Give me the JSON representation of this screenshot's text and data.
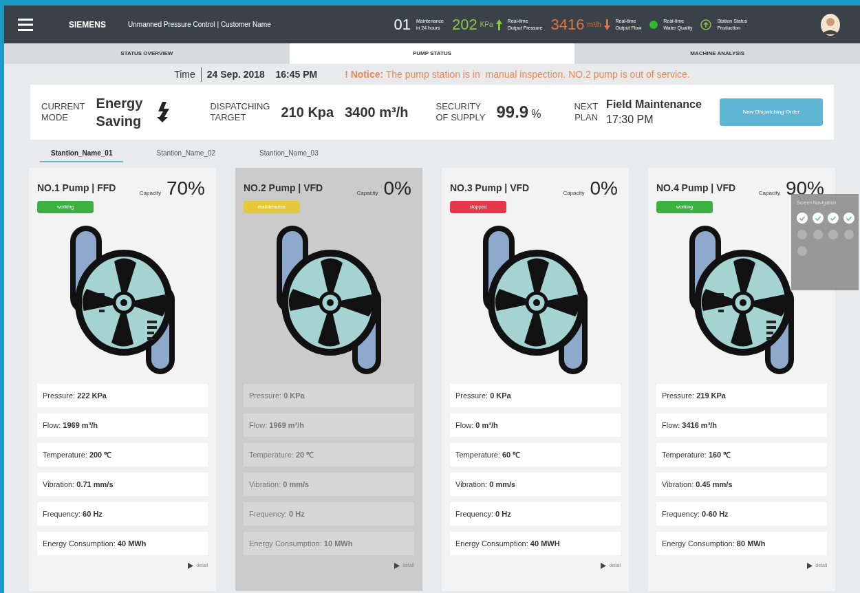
{
  "top_bar": {
    "brand": "SIEMENS",
    "title": "Unmanned Pressure Control | Customer Name",
    "stats": [
      {
        "kind": "count",
        "value": "01",
        "caption": [
          "Maintenance",
          "in 24 hours"
        ]
      },
      {
        "kind": "up",
        "value": "202",
        "unit": "KPa",
        "caption": [
          "Real-time",
          "Output Pressure"
        ]
      },
      {
        "kind": "down",
        "value": "3416",
        "unit": "m³/h",
        "caption": [
          "Real-time",
          "Output Flow"
        ]
      },
      {
        "kind": "dot",
        "caption": [
          "Real-time",
          "Water Quality"
        ]
      },
      {
        "kind": "status",
        "caption": [
          "Station Status",
          "Production"
        ]
      }
    ]
  },
  "tabs": [
    {
      "label": "STATUS OVERVIEW",
      "selected": false
    },
    {
      "label": "PUMP STATUS",
      "selected": true
    },
    {
      "label": "MACHINE ANALYSIS",
      "selected": false
    }
  ],
  "time_label": "Time",
  "time_value": "24 Sep. 2018    16:45 PM",
  "notice": "**! Notice:** The pump station is in  manual inspection. NO.2 pump is out of service.",
  "info": {
    "mode_label": [
      "CURRENT",
      "MODE"
    ],
    "mode": "Energy Saving",
    "target_label": [
      "DISPATCHING",
      "TARGET"
    ],
    "target_pressure": "210 Kpa",
    "target_flow": "3400 m³/h",
    "security_label": [
      "SECURITY",
      "OF SUPPLY"
    ],
    "security_value": "99.9",
    "security_unit": "%",
    "plan_label": [
      "NEXT",
      "PLAN"
    ],
    "plan_title": "Field Maintenance",
    "plan_time": "17:30 PM",
    "button": "New Dispatching Order"
  },
  "stations": [
    {
      "label": "Stantion_Name_01",
      "selected": true
    },
    {
      "label": "Stantion_Name_02",
      "selected": false
    },
    {
      "label": "Stantion_Name_03",
      "selected": false
    }
  ],
  "pumps": [
    {
      "title": "NO.1 Pump | FFD",
      "capacity_label": "Capacity",
      "capacity": "70%",
      "status": "working",
      "metrics": [
        "Pressure: **222 KPa**",
        "Flow: **1969 m³/h**",
        "Temperature: **200 ℃**",
        "Vibration: **0.71 mm/s**",
        "Frequency: **60 Hz**",
        "Energy Consumption: **40 MWh**"
      ],
      "detail": "detail"
    },
    {
      "title": "NO.2 Pump | VFD",
      "capacity_label": "Capacity",
      "capacity": "0%",
      "status": "maintenance",
      "metrics": [
        "Pressure: **0 KPa**",
        "Flow: **1969 m³/h**",
        "Temperature: **20 ℃**",
        "Vibration: **0 mm/s**",
        "Frequency: **0 Hz**",
        "Energy Consumption: **10 MWh**"
      ],
      "detail": "detail"
    },
    {
      "title": "NO.3 Pump | VFD",
      "capacity_label": "Capacity",
      "capacity": "0%",
      "status": "stopped",
      "metrics": [
        "Pressure: **0 KPa**",
        "Flow: **0 m³/h**",
        "Temperature: **60 ℃**",
        "Vibration: **0 mm/s**",
        "Frequency: **0 Hz**",
        "Energy Consumption: **40 MWH**"
      ],
      "detail": "detail"
    },
    {
      "title": "NO.4 Pump | VFD",
      "capacity_label": "Capacity",
      "capacity": "90%",
      "status": "working",
      "metrics": [
        "Pressure: **219 KPa**",
        "Flow: **3416 m³/h**",
        "Temperature: **160 ℃**",
        "Vibration: **0.45 mm/s**",
        "Frequency: **0-60 Hz**",
        "Energy Consumption: **80 MWh**"
      ],
      "detail": "detail"
    }
  ],
  "screen_navigation": {
    "title": "Screen Navigation",
    "items": [
      {
        "checked": true
      },
      {
        "checked": true
      },
      {
        "checked": true
      },
      {
        "checked": true
      },
      {
        "checked": false
      },
      {
        "checked": false
      },
      {
        "checked": false
      },
      {
        "checked": false
      },
      {
        "checked": false
      }
    ]
  }
}
